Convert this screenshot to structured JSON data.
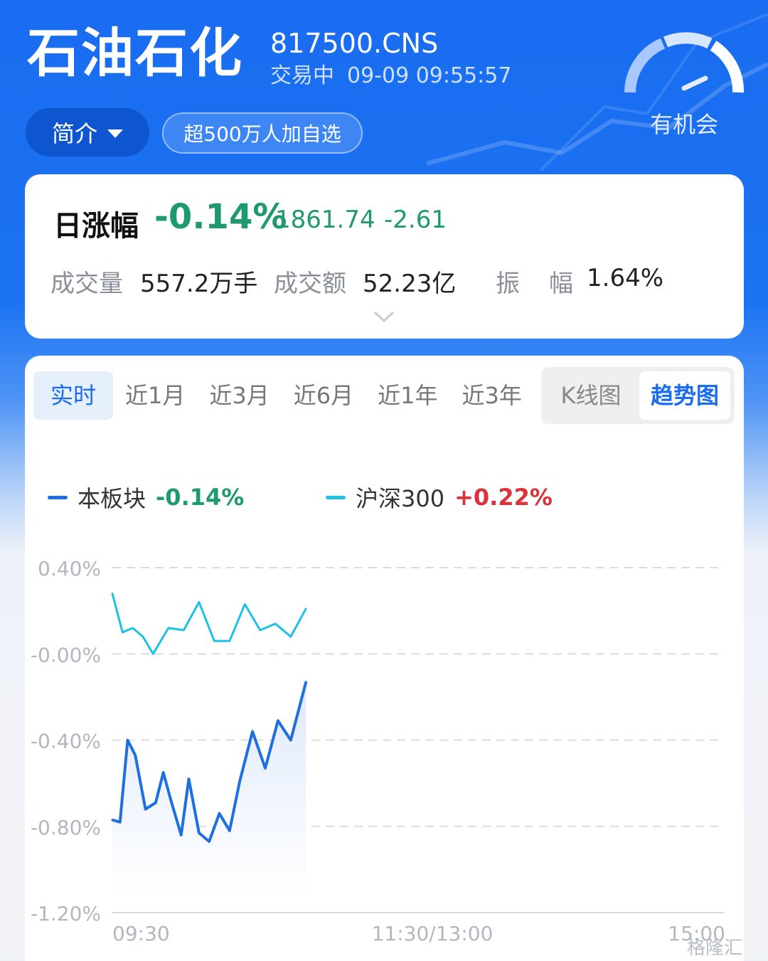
{
  "header": {
    "title": "石油石化",
    "code": "817500.CNS",
    "status": "交易中",
    "datetime": "09-09 09:55:57",
    "intro_label": "简介",
    "watch_label": "超500万人加自选",
    "gauge_label": "有机会"
  },
  "stats": {
    "change_title": "日涨幅",
    "change_pct": "-0.14%",
    "price": "1861.74",
    "change_abs": "-2.61",
    "volume_label": "成交量",
    "volume_value": "557.2万手",
    "amount_label": "成交额",
    "amount_value": "52.23亿",
    "amplitude_label_1": "振",
    "amplitude_label_2": "幅",
    "amplitude_value": "1.64%"
  },
  "tabs": [
    "实时",
    "近1月",
    "近3月",
    "近6月",
    "近1年",
    "近3年"
  ],
  "active_tab": 0,
  "chart_types": [
    "K线图",
    "趋势图"
  ],
  "active_chart_type": 1,
  "colors": {
    "down": "#1f9a6e",
    "up": "#d8333b",
    "sector_line": "#1f6fe0",
    "index_line": "#1ec0e6"
  },
  "watermark": "格隆汇",
  "chart_data": {
    "type": "line",
    "y_ticks": [
      "0.40%",
      "-0.00%",
      "-0.40%",
      "-0.80%",
      "-1.20%"
    ],
    "ylim": [
      -1.2,
      0.4
    ],
    "x_ticks": [
      "09:30",
      "11:30/13:00",
      "15:00"
    ],
    "grid": true,
    "legend_position": "top",
    "series": [
      {
        "name": "本板块",
        "pct_label": "-0.14%",
        "values": [
          -0.77,
          -0.78,
          -0.4,
          -0.47,
          -0.72,
          -0.69,
          -0.55,
          -0.68,
          -0.84,
          -0.58,
          -0.83,
          -0.87,
          -0.74,
          -0.82,
          -0.59,
          -0.36,
          -0.53,
          -0.31,
          -0.4,
          -0.13
        ]
      },
      {
        "name": "沪深300",
        "pct_label": "+0.22%",
        "values": [
          0.28,
          0.1,
          0.12,
          0.08,
          -0.0,
          0.12,
          0.11,
          0.24,
          0.06,
          0.06,
          0.23,
          0.11,
          0.14,
          0.08,
          0.21
        ]
      }
    ],
    "x_positions_sector": [
      0,
      3,
      6,
      9,
      13,
      17,
      20,
      23,
      27,
      30,
      34,
      38,
      42,
      46,
      50,
      55,
      60,
      65,
      70,
      76
    ],
    "x_positions_index": [
      0,
      4,
      8,
      12,
      16,
      22,
      28,
      34,
      40,
      46,
      52,
      58,
      64,
      70,
      76
    ],
    "total_minutes": 240
  }
}
